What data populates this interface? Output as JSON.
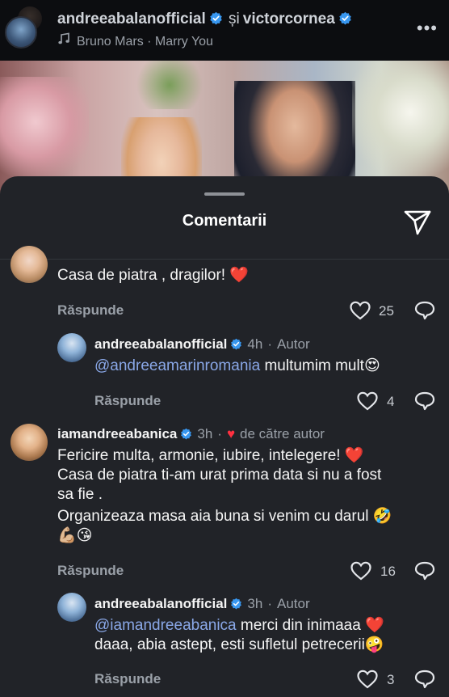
{
  "reel": {
    "author": "andreeabalanofficial",
    "conjunction": "și",
    "coauthor": "victorcornea",
    "audio": "Bruno Mars · Marry You"
  },
  "sheet": {
    "title": "Comentarii"
  },
  "comments": [
    {
      "text": "Casa de piatra , dragilor! ❤️",
      "reply_label": "Răspunde",
      "likes": "25"
    },
    {
      "username": "andreeabalanofficial",
      "time": "4h",
      "badge": "Autor",
      "mention": "@andreeamarinromania",
      "text": " multumim mult😍",
      "reply_label": "Răspunde",
      "likes": "4"
    },
    {
      "username": "iamandreeabanica",
      "time": "3h",
      "liked_by": "de către autor",
      "line1": "Fericire multa, armonie, iubire, intelegere! ❤️",
      "line2": "Casa de piatra ti-am urat prima data si nu a fost",
      "line3": "sa fie .",
      "line4": "Organizeaza masa aia buna si venim cu darul 🤣",
      "line5": "💪🏼😘",
      "reply_label": "Răspunde",
      "likes": "16"
    },
    {
      "username": "andreeabalanofficial",
      "time": "3h",
      "badge": "Autor",
      "mention": "@iamandreeabanica",
      "text": " merci din inimaaa ❤️",
      "line2": "daaa, abia astept, esti sufletul petrecerii🤪",
      "reply_label": "Răspunde",
      "likes": "3"
    }
  ],
  "colors": {
    "accent_mention": "#8aa8e8",
    "verified": "#3897f0",
    "heart": "#ff3040"
  }
}
